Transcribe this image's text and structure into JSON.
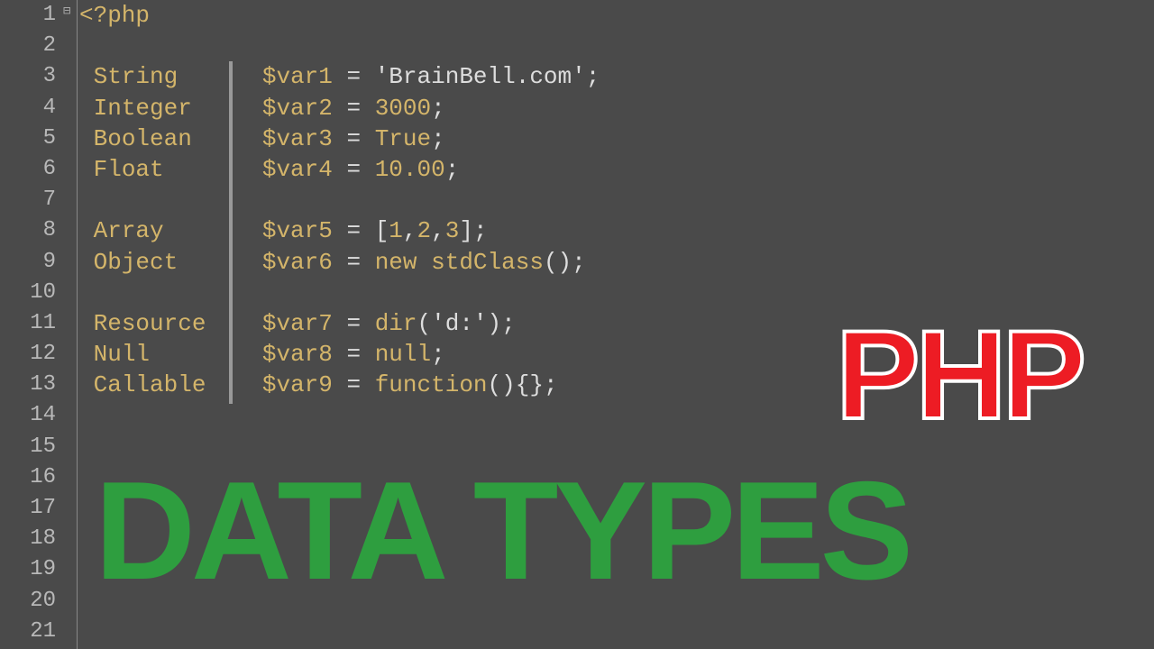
{
  "editor": {
    "total_lines": 21,
    "open_tag": "<?php",
    "lines": [
      {
        "n": 1,
        "type": "",
        "var": "",
        "code": ""
      },
      {
        "n": 2,
        "type": "",
        "var": "",
        "code": ""
      },
      {
        "n": 3,
        "type": "String",
        "var": "$var1",
        "assign": "=",
        "value": "'BrainBell.com'",
        "end": ";"
      },
      {
        "n": 4,
        "type": "Integer",
        "var": "$var2",
        "assign": "=",
        "value": "3000",
        "end": ";"
      },
      {
        "n": 5,
        "type": "Boolean",
        "var": "$var3",
        "assign": "=",
        "value": "True",
        "end": ";"
      },
      {
        "n": 6,
        "type": "Float",
        "var": "$var4",
        "assign": "=",
        "value": "10.00",
        "end": ";"
      },
      {
        "n": 7,
        "type": "",
        "var": "",
        "code": ""
      },
      {
        "n": 8,
        "type": "Array",
        "var": "$var5",
        "assign": "=",
        "value": "[1,2,3]",
        "end": ";"
      },
      {
        "n": 9,
        "type": "Object",
        "var": "$var6",
        "assign": "=",
        "kw": "new",
        "call": "stdClass",
        "args": "()",
        "end": ";"
      },
      {
        "n": 10,
        "type": "",
        "var": "",
        "code": ""
      },
      {
        "n": 11,
        "type": "Resource",
        "var": "$var7",
        "assign": "=",
        "call": "dir",
        "args": "('d:')",
        "end": ";"
      },
      {
        "n": 12,
        "type": "Null",
        "var": "$var8",
        "assign": "=",
        "value": "null",
        "end": ";"
      },
      {
        "n": 13,
        "type": "Callable",
        "var": "$var9",
        "assign": "=",
        "kw": "function",
        "args": "(){}",
        "end": ";"
      },
      {
        "n": 14
      },
      {
        "n": 15
      },
      {
        "n": 16
      },
      {
        "n": 17
      },
      {
        "n": 18
      },
      {
        "n": 19
      },
      {
        "n": 20
      },
      {
        "n": 21
      }
    ]
  },
  "overlay": {
    "php": "PHP",
    "types": "DATA TYPES"
  }
}
